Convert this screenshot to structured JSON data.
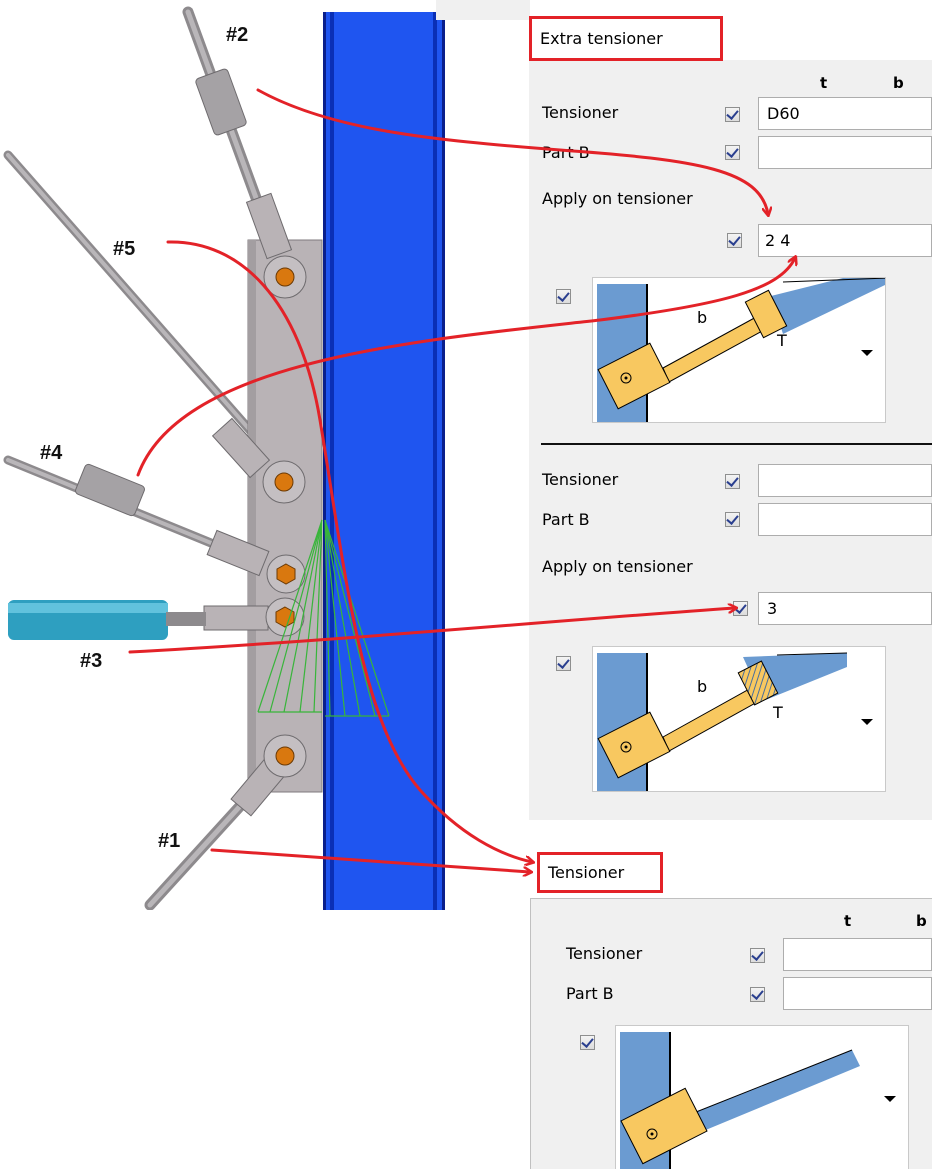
{
  "drawing": {
    "labels": {
      "n2": "#2",
      "n5": "#5",
      "n4": "#4",
      "n3": "#3",
      "n1": "#1"
    }
  },
  "extra_tensioner": {
    "tab_label": "Extra tensioner",
    "col_t": "t",
    "col_b": "b",
    "group1": {
      "tensioner_label": "Tensioner",
      "tensioner_value": "D60",
      "partb_label": "Part B",
      "partb_value": "",
      "apply_label": "Apply on tensioner",
      "apply_value": "2 4",
      "pic_label_b": "b",
      "pic_label_t": "T"
    },
    "group2": {
      "tensioner_label": "Tensioner",
      "tensioner_value": "",
      "partb_label": "Part B",
      "partb_value": "",
      "apply_label": "Apply on tensioner",
      "apply_value": "3",
      "pic_label_b": "b",
      "pic_label_t": "T"
    }
  },
  "tensioner": {
    "tab_label": "Tensioner",
    "col_t": "t",
    "col_b": "b",
    "tensioner_label": "Tensioner",
    "tensioner_value": "",
    "partb_label": "Part B",
    "partb_value": ""
  },
  "colors": {
    "annotation_red": "#e32228",
    "column_blue": "#1f55f0",
    "plate_grey": "#b9b3b6",
    "bolt_orange": "#d9780f",
    "rod_teal": "#2e9fc0",
    "pic_blue": "#6b9bd1",
    "pic_yellow": "#f8c860"
  }
}
